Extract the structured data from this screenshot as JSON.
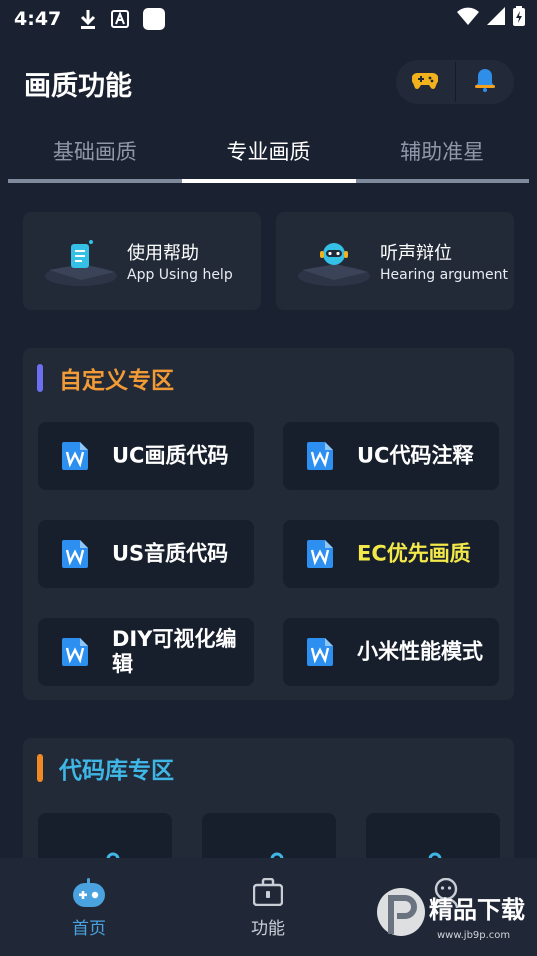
{
  "status_bar": {
    "time": "4:47"
  },
  "header": {
    "title": "画质功能"
  },
  "tabs": [
    {
      "label": "基础画质"
    },
    {
      "label": "专业画质"
    },
    {
      "label": "辅助准星"
    }
  ],
  "help_cards": [
    {
      "title": "使用帮助",
      "subtitle": "App Using help"
    },
    {
      "title": "听声辩位",
      "subtitle": "Hearing argument"
    }
  ],
  "custom_section": {
    "title": "自定义专区",
    "title_color": "#f29a35",
    "bar_color": "#6b6ff0",
    "buttons": [
      {
        "label": "UC画质代码",
        "color": "#ffffff"
      },
      {
        "label": "UC代码注释",
        "color": "#ffffff"
      },
      {
        "label": "US音质代码",
        "color": "#ffffff"
      },
      {
        "label": "EC优先画质",
        "color": "#f2e84a"
      },
      {
        "label": "DIY可视化编辑",
        "color": "#ffffff"
      },
      {
        "label": "小米性能模式",
        "color": "#ffffff"
      }
    ]
  },
  "library_section": {
    "title": "代码库专区",
    "title_color": "#3fb6e6",
    "bar_color": "#f28a24"
  },
  "bottom_nav": [
    {
      "label": "首页",
      "icon": "gamepad-icon",
      "active": true
    },
    {
      "label": "功能",
      "icon": "toolbox-icon",
      "active": false
    },
    {
      "label": "",
      "icon": "user-icon",
      "active": false
    }
  ],
  "watermark": {
    "text": "精品下载",
    "url_text": "www.jb9p.com"
  }
}
